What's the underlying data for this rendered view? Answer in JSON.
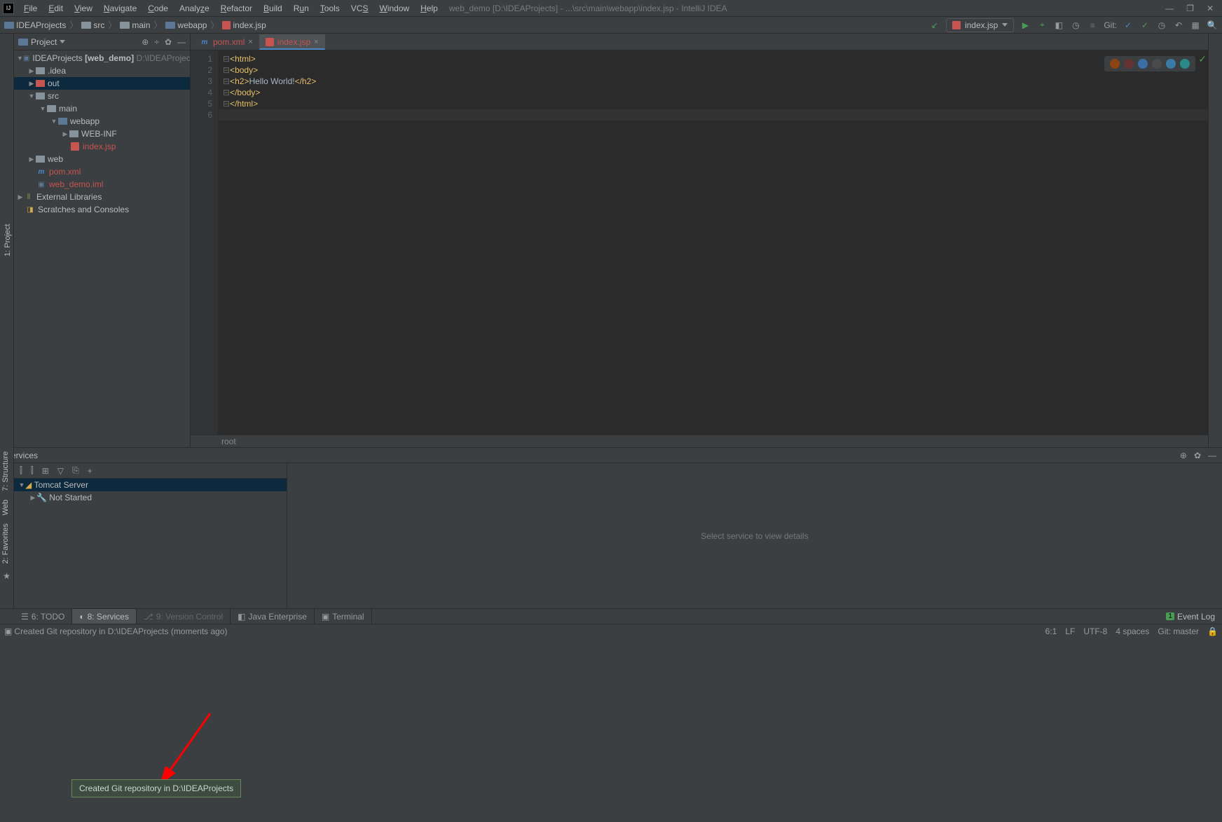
{
  "menubar": {
    "items": [
      "File",
      "Edit",
      "View",
      "Navigate",
      "Code",
      "Analyze",
      "Refactor",
      "Build",
      "Run",
      "Tools",
      "VCS",
      "Window",
      "Help"
    ],
    "title": "web_demo [D:\\IDEAProjects] - ...\\src\\main\\webapp\\index.jsp - IntelliJ IDEA"
  },
  "breadcrumbs": {
    "items": [
      "IDEAProjects",
      "src",
      "main",
      "webapp",
      "index.jsp"
    ]
  },
  "toolbar": {
    "run_config": "index.jsp",
    "git_label": "Git:"
  },
  "project_panel": {
    "title": "Project",
    "tree": {
      "root_name": "IDEAProjects",
      "root_module": "[web_demo]",
      "root_path": "D:\\IDEAProjects",
      "idea": ".idea",
      "out": "out",
      "src": "src",
      "main": "main",
      "webapp": "webapp",
      "webinf": "WEB-INF",
      "indexjsp": "index.jsp",
      "web": "web",
      "pom": "pom.xml",
      "iml": "web_demo.iml",
      "libs": "External Libraries",
      "scratches": "Scratches and Consoles"
    }
  },
  "editor": {
    "tabs": [
      {
        "label": "pom.xml",
        "icon": "m",
        "active": false
      },
      {
        "label": "index.jsp",
        "icon": "jsp",
        "active": true
      }
    ],
    "lines": [
      "1",
      "2",
      "3",
      "4",
      "5",
      "6"
    ],
    "code": {
      "l1": "<html>",
      "l2": "<body>",
      "l3_open": "<h2>",
      "l3_text": "Hello World!",
      "l3_close": "</h2>",
      "l4": "</body>",
      "l5": "</html>"
    },
    "footer_crumb": "root"
  },
  "services": {
    "title": "Services",
    "tomcat": "Tomcat Server",
    "not_started": "Not Started",
    "detail_placeholder": "Select service to view details"
  },
  "bottom_tabs": {
    "todo": "6: TODO",
    "services": "8: Services",
    "vcs": "9: Version Control",
    "javaee": "Java Enterprise",
    "terminal": "Terminal",
    "event_log": "Event Log"
  },
  "status_bar": {
    "message": "Created Git repository in D:\\IDEAProjects (moments ago)",
    "cursor": "6:1",
    "lf": "LF",
    "encoding": "UTF-8",
    "indent": "4 spaces",
    "branch": "Git: master"
  },
  "tooltip": "Created Git repository in D:\\IDEAProjects",
  "left_tabs": {
    "project": "1: Project",
    "structure": "7: Structure",
    "web": "Web",
    "favorites": "2: Favorites"
  }
}
